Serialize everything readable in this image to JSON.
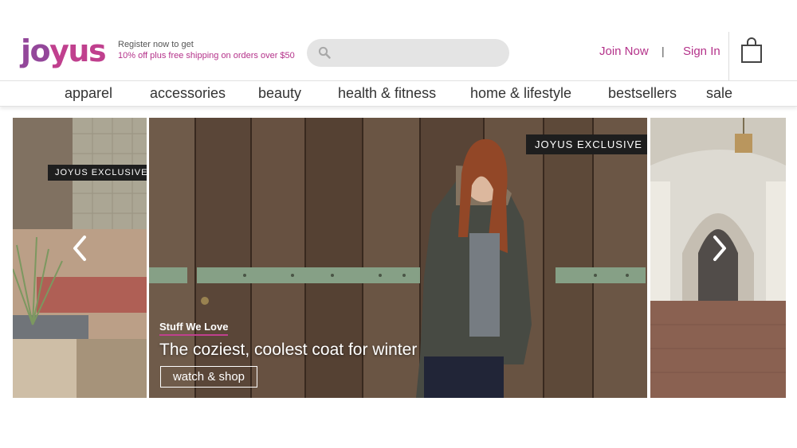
{
  "header": {
    "logo": {
      "prefix": "jo",
      "accent": "yus"
    },
    "promo_line1": "Register now to get",
    "promo_line2": "10% off plus free shipping on orders over $50",
    "search_placeholder": "",
    "join_label": "Join Now",
    "separator": "|",
    "signin_label": "Sign In",
    "bag_icon": "shopping-bag-icon"
  },
  "nav": {
    "items": [
      "apparel",
      "accessories",
      "beauty",
      "health & fitness",
      "home & lifestyle",
      "bestsellers",
      "sale"
    ]
  },
  "carousel": {
    "left_badge": "JOYUS EXCLUSIVE",
    "main_badge": "JOYUS EXCLUSIVE",
    "kicker": "Stuff We Love",
    "title": "The coziest, coolest coat for winter",
    "cta": "watch & shop",
    "prev_icon": "chevron-left-icon",
    "next_icon": "chevron-right-icon"
  },
  "colors": {
    "brand_purple": "#93479a",
    "brand_magenta": "#b4328a",
    "badge_bg": "#1e1e1e"
  }
}
